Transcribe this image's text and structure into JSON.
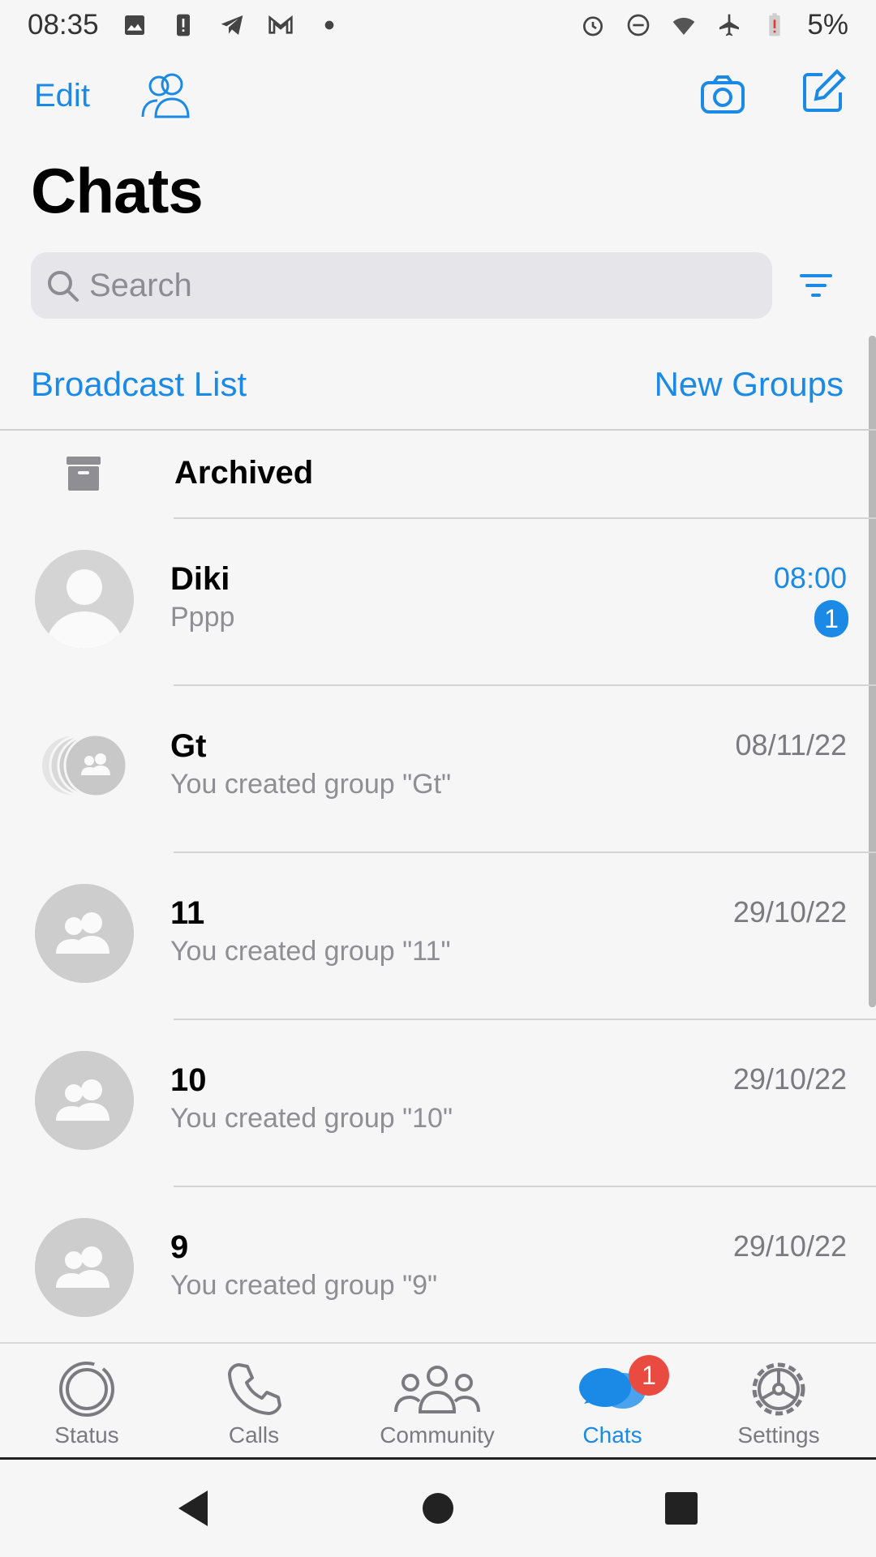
{
  "status_bar": {
    "time": "08:35",
    "battery": "5%",
    "left_icons": [
      "photo-icon",
      "alert-icon",
      "telegram-icon",
      "gmail-icon",
      "dot-icon"
    ],
    "right_icons": [
      "alarm-icon",
      "dnd-icon",
      "wifi-icon",
      "airplane-icon",
      "battery-icon"
    ]
  },
  "header": {
    "edit_label": "Edit",
    "title": "Chats"
  },
  "search": {
    "placeholder": "Search"
  },
  "links": {
    "broadcast": "Broadcast List",
    "new_groups": "New Groups"
  },
  "archived": {
    "label": "Archived"
  },
  "chats": [
    {
      "name": "Diki",
      "preview": "Pppp",
      "time": "08:00",
      "unread": "1",
      "avatar": "person"
    },
    {
      "name": "Gt",
      "preview": "You created group \"Gt\"",
      "time": "08/11/22",
      "avatar": "group-stack"
    },
    {
      "name": "11",
      "preview": "You created group \"11\"",
      "time": "29/10/22",
      "avatar": "group"
    },
    {
      "name": "10",
      "preview": "You created group \"10\"",
      "time": "29/10/22",
      "avatar": "group"
    },
    {
      "name": "9",
      "preview": "You created group \"9\"",
      "time": "29/10/22",
      "avatar": "group"
    }
  ],
  "tabs": [
    {
      "label": "Status",
      "icon": "status-icon"
    },
    {
      "label": "Calls",
      "icon": "phone-icon"
    },
    {
      "label": "Community",
      "icon": "community-icon"
    },
    {
      "label": "Chats",
      "icon": "chats-icon",
      "active": true,
      "badge": "1"
    },
    {
      "label": "Settings",
      "icon": "gear-icon"
    }
  ],
  "colors": {
    "accent": "#1a8ae6",
    "badge_red": "#ea4b40",
    "background": "#f6f6f6"
  }
}
